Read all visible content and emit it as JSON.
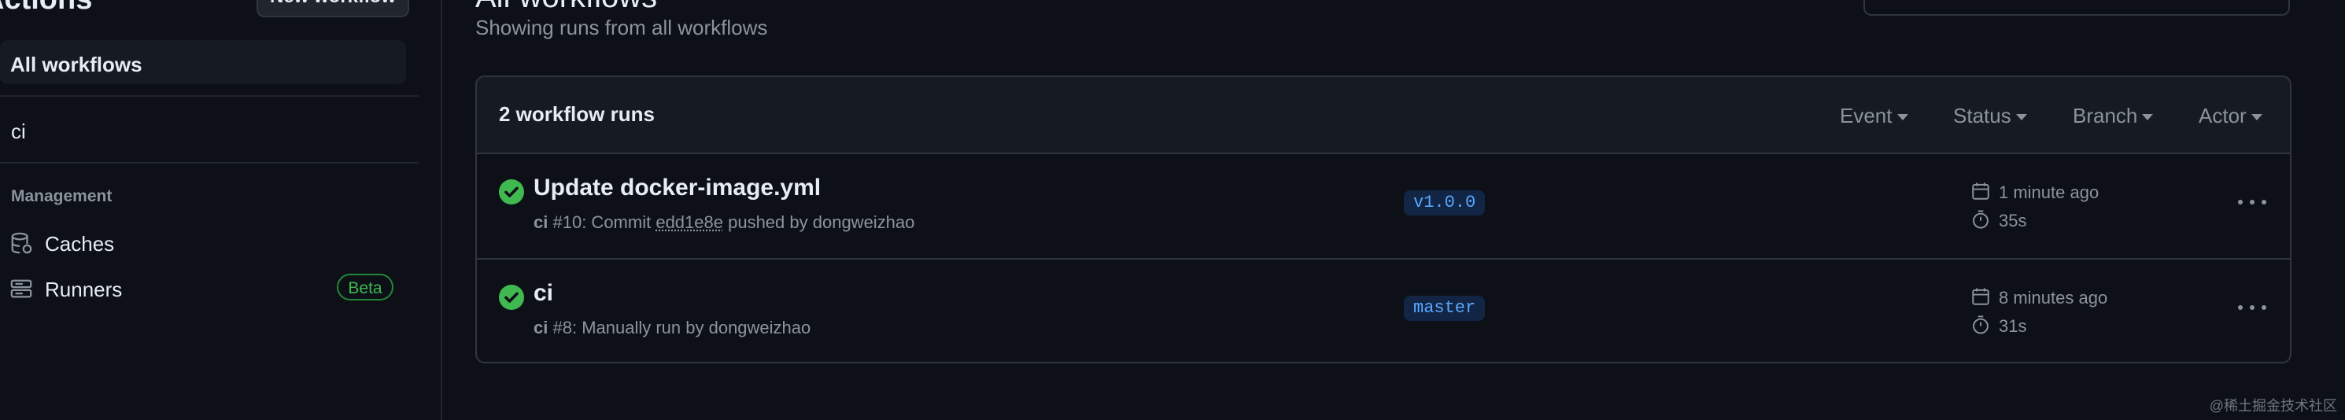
{
  "sidebar": {
    "title": "Actions",
    "new_workflow_label": "New workflow",
    "all_workflows_label": "All workflows",
    "workflows": [
      {
        "label": "ci"
      }
    ],
    "management_heading": "Management",
    "management_items": [
      {
        "label": "Caches",
        "icon": "database-icon"
      },
      {
        "label": "Runners",
        "icon": "server-icon",
        "badge": "Beta"
      }
    ]
  },
  "main": {
    "title": "All workflows",
    "subtitle": "Showing runs from all workflows",
    "runs_count_label": "2 workflow runs",
    "filters": [
      "Event",
      "Status",
      "Branch",
      "Actor"
    ],
    "runs": [
      {
        "title": "Update docker-image.yml",
        "workflow": "ci",
        "run_number": "#10",
        "meta_prefix": ": Commit ",
        "commit": "edd1e8e",
        "meta_suffix": " pushed by dongweizhao",
        "branch": "v1.0.0",
        "time_ago": "1 minute ago",
        "duration": "35s",
        "status": "success"
      },
      {
        "title": "ci",
        "workflow": "ci",
        "run_number": "#8",
        "meta_prefix": ": Manually run by dongweizhao",
        "commit": "",
        "meta_suffix": "",
        "branch": "master",
        "time_ago": "8 minutes ago",
        "duration": "31s",
        "status": "success"
      }
    ]
  },
  "watermark": "@稀土掘金技术社区",
  "colors": {
    "background": "#0d1117",
    "success": "#3fb950",
    "branch_text": "#58a6ff",
    "muted": "#8b949e"
  }
}
